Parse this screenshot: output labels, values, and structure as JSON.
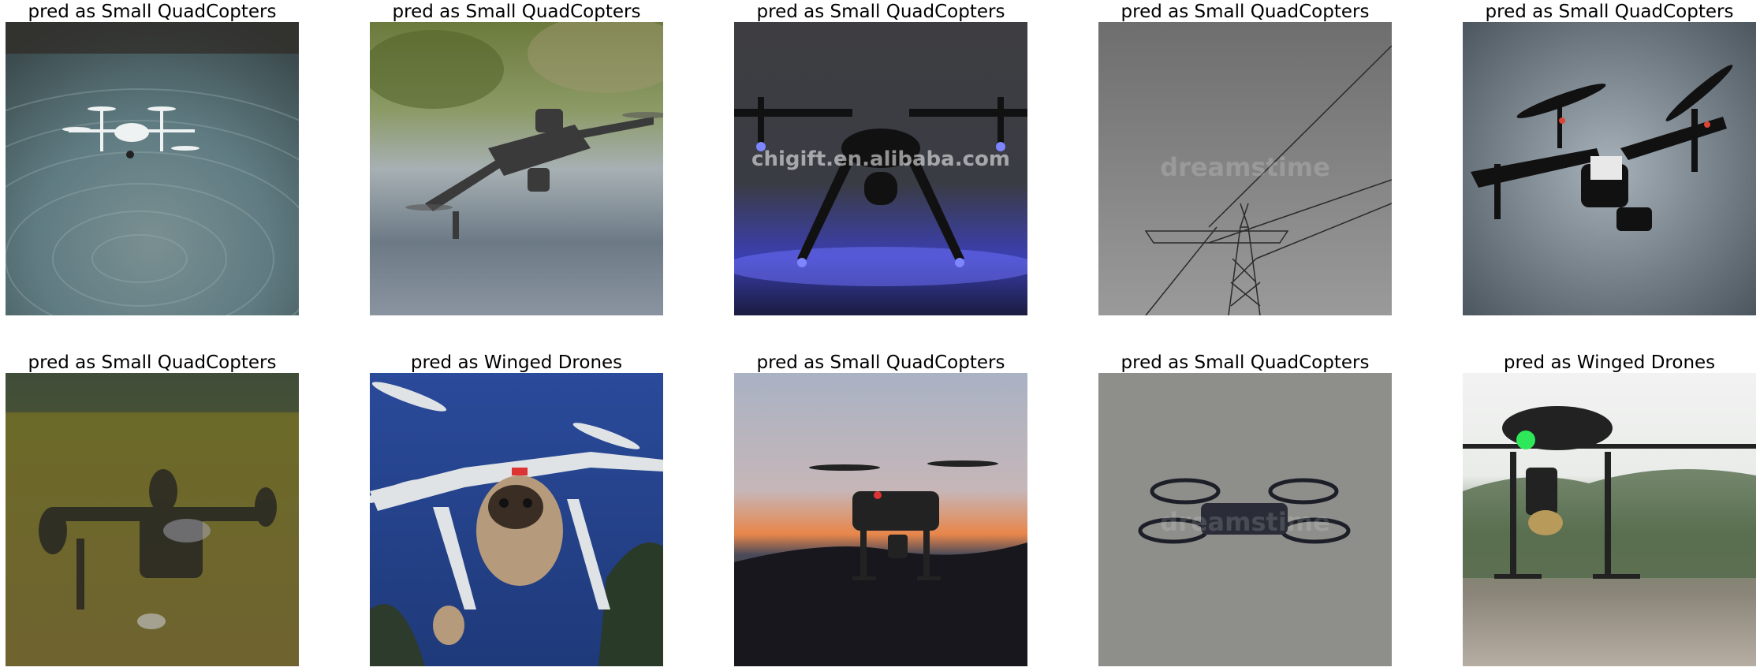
{
  "grid": {
    "rows": 2,
    "cols": 5,
    "items": [
      {
        "caption": "pred as Small QuadCopters",
        "scene": "drone over rippled water"
      },
      {
        "caption": "pred as Small QuadCopters",
        "scene": "folding drone over blurred river"
      },
      {
        "caption": "pred as Small QuadCopters",
        "scene": "drone with blue lights, dark background",
        "watermark": "chigift.en.alibaba.com"
      },
      {
        "caption": "pred as Small QuadCopters",
        "scene": "power pylon in grey sky",
        "watermark": "dreamstime"
      },
      {
        "caption": "pred as Small QuadCopters",
        "scene": "camera drone in cloudy sky"
      },
      {
        "caption": "pred as Small QuadCopters",
        "scene": "blurry drone over grass field"
      },
      {
        "caption": "pred as Winged Drones",
        "scene": "pug carried by drone, blue sky"
      },
      {
        "caption": "pred as Small QuadCopters",
        "scene": "drone at sunset"
      },
      {
        "caption": "pred as Small QuadCopters",
        "scene": "small drone on grey background",
        "watermark": "dreamstime"
      },
      {
        "caption": "pred as Winged Drones",
        "scene": "drone with green light over lake"
      }
    ]
  }
}
